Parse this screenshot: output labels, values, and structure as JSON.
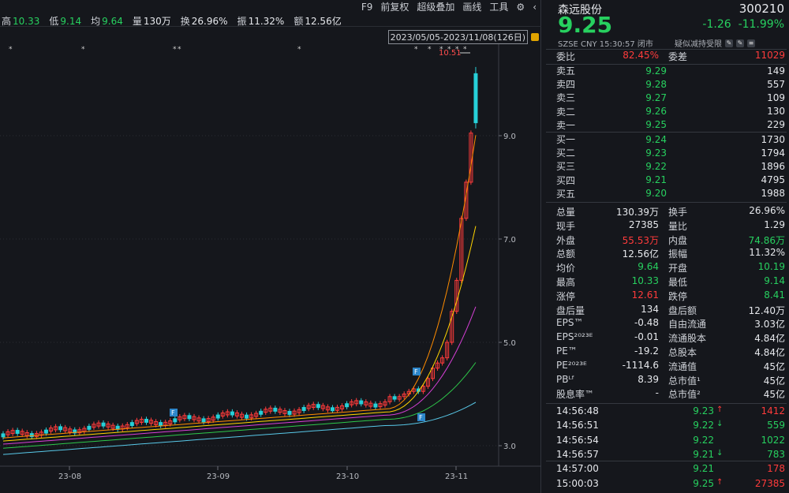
{
  "topbar": {
    "tools": [
      "F9",
      "前复权",
      "超级叠加",
      "画线",
      "工具"
    ],
    "quote": [
      {
        "label": "高",
        "value": "10.33",
        "color": "g"
      },
      {
        "label": "低",
        "value": "9.14",
        "color": "g"
      },
      {
        "label": "均",
        "value": "9.64",
        "color": "g"
      },
      {
        "label": "量",
        "value": "130万",
        "color": "w"
      },
      {
        "label": "换",
        "value": "26.96%",
        "color": "w"
      },
      {
        "label": "振",
        "value": "11.32%",
        "color": "w"
      },
      {
        "label": "额",
        "value": "12.56亿",
        "color": "w"
      }
    ],
    "date_range": "2023/05/05-2023/11/08(126日)"
  },
  "chart_data": {
    "type": "candlestick",
    "y_ticks": [
      "9.0",
      "7.0",
      "5.0",
      "3.0"
    ],
    "x_ticks": [
      "23-08",
      "23-09",
      "23-10",
      "23-11"
    ],
    "high_label": "10.51",
    "colors": {
      "up": "#ff3b3b",
      "down": "#27d0d8",
      "ma5": "#e0e0e0",
      "ma10": "#ffd400",
      "ma20": "#ff8c00",
      "ma30": "#d63fd6",
      "ma60": "#2ec84a",
      "ma120": "#58c8e8"
    }
  },
  "quote_panel": {
    "name": "森远股份",
    "code": "300210",
    "price": "9.25",
    "change": "-1.26",
    "change_pct": "-11.99%",
    "meta": "SZSE  CNY  15:30:57  闭市",
    "meta2": "疑似减持受限",
    "weibi": {
      "label": "委比",
      "value": "82.45%",
      "label2": "委差",
      "value2": "11029"
    },
    "asks": [
      {
        "label": "卖五",
        "price": "9.29",
        "vol": "149"
      },
      {
        "label": "卖四",
        "price": "9.28",
        "vol": "557"
      },
      {
        "label": "卖三",
        "price": "9.27",
        "vol": "109"
      },
      {
        "label": "卖二",
        "price": "9.26",
        "vol": "130"
      },
      {
        "label": "卖一",
        "price": "9.25",
        "vol": "229"
      }
    ],
    "bids": [
      {
        "label": "买一",
        "price": "9.24",
        "vol": "1730"
      },
      {
        "label": "买二",
        "price": "9.23",
        "vol": "1794"
      },
      {
        "label": "买三",
        "price": "9.22",
        "vol": "1896"
      },
      {
        "label": "买四",
        "price": "9.21",
        "vol": "4795"
      },
      {
        "label": "买五",
        "price": "9.20",
        "vol": "1988"
      }
    ],
    "stats": [
      {
        "a": "总量",
        "b": "130.39万",
        "bc": "w",
        "c": "换手",
        "d": "26.96%",
        "dc": "w"
      },
      {
        "a": "现手",
        "b": "27385",
        "bc": "w",
        "c": "量比",
        "d": "1.29",
        "dc": "w"
      },
      {
        "a": "外盘",
        "b": "55.53万",
        "bc": "r",
        "c": "内盘",
        "d": "74.86万",
        "dc": "g"
      },
      {
        "a": "总额",
        "b": "12.56亿",
        "bc": "w",
        "c": "振幅",
        "d": "11.32%",
        "dc": "w"
      },
      {
        "a": "均价",
        "b": "9.64",
        "bc": "g",
        "c": "开盘",
        "d": "10.19",
        "dc": "g"
      },
      {
        "a": "最高",
        "b": "10.33",
        "bc": "g",
        "c": "最低",
        "d": "9.14",
        "dc": "g"
      },
      {
        "a": "涨停",
        "b": "12.61",
        "bc": "r",
        "c": "跌停",
        "d": "8.41",
        "dc": "g"
      },
      {
        "a": "盘后量",
        "b": "134",
        "bc": "w",
        "c": "盘后额",
        "d": "12.40万",
        "dc": "w"
      },
      {
        "a": "EPS™",
        "b": "-0.48",
        "bc": "w",
        "c": "自由流通",
        "d": "3.03亿",
        "dc": "w"
      },
      {
        "a": "EPS²⁰²³ᴱ",
        "b": "-0.01",
        "bc": "w",
        "c": "流通股本",
        "d": "4.84亿",
        "dc": "w"
      },
      {
        "a": "PE™",
        "b": "-19.2",
        "bc": "w",
        "c": "总股本",
        "d": "4.84亿",
        "dc": "w"
      },
      {
        "a": "PE²⁰²³ᴱ",
        "b": "-1114.6",
        "bc": "w",
        "c": "流通值",
        "d": "45亿",
        "dc": "w"
      },
      {
        "a": "PBᴸᶠ",
        "b": "8.39",
        "bc": "w",
        "c": "总市值¹",
        "d": "45亿",
        "dc": "w"
      },
      {
        "a": "股息率™",
        "b": "-",
        "bc": "w",
        "c": "总市值²",
        "d": "45亿",
        "dc": "w"
      }
    ],
    "ticks": [
      {
        "t": "14:56:48",
        "p": "9.23",
        "pc": "g",
        "arr": "↑",
        "ac": "r",
        "v": "1412",
        "vc": "r"
      },
      {
        "t": "14:56:51",
        "p": "9.22",
        "pc": "g",
        "arr": "↓",
        "ac": "g",
        "v": "559",
        "vc": "g"
      },
      {
        "t": "14:56:54",
        "p": "9.22",
        "pc": "g",
        "arr": "",
        "ac": "w",
        "v": "1022",
        "vc": "g"
      },
      {
        "t": "14:56:57",
        "p": "9.21",
        "pc": "g",
        "arr": "↓",
        "ac": "g",
        "v": "783",
        "vc": "g"
      },
      {
        "t": "14:57:00",
        "p": "9.21",
        "pc": "g",
        "arr": "",
        "ac": "w",
        "v": "178",
        "vc": "r"
      },
      {
        "t": "15:00:03",
        "p": "9.25",
        "pc": "g",
        "arr": "↑",
        "ac": "r",
        "v": "27385",
        "vc": "r"
      }
    ]
  }
}
